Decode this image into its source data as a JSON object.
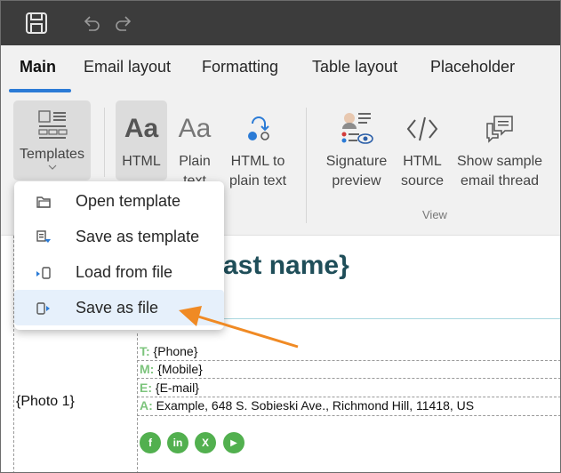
{
  "tabs": [
    "Main",
    "Email layout",
    "Formatting",
    "Table layout",
    "Placeholder"
  ],
  "ribbon": {
    "templates": "Templates",
    "html": "HTML",
    "plain_text": [
      "Plain",
      "text"
    ],
    "html_to_plain": [
      "HTML to",
      "plain text"
    ],
    "signature_preview": [
      "Signature",
      "preview"
    ],
    "html_source": [
      "HTML",
      "source"
    ],
    "show_sample": [
      "Show sample",
      "email thread"
    ],
    "view_group": "View",
    "aa_big": "Aa",
    "aa_light": "Aa"
  },
  "menu": {
    "items": [
      "Open template",
      "Save as template",
      "Load from file",
      "Save as file"
    ],
    "highlighted": "Save as file"
  },
  "document": {
    "name_fragment": "ast name}",
    "photo": "{Photo 1}",
    "lines": [
      {
        "label": "T:",
        "value": " {Phone}"
      },
      {
        "label": "M:",
        "value": " {Mobile}"
      },
      {
        "label": "E:",
        "value": " {E-mail}"
      },
      {
        "label": "A:",
        "value": " Example, 648 S. Sobieski Ave., Richmond Hill, 11418, US"
      }
    ],
    "social": [
      "f",
      "in",
      "X",
      "▶"
    ]
  },
  "colors": {
    "accent": "#2b7bd6",
    "arrow": "#f08a24",
    "name_color": "#1f4e59",
    "label_green": "#7cc47c",
    "social_green": "#52b04f"
  }
}
